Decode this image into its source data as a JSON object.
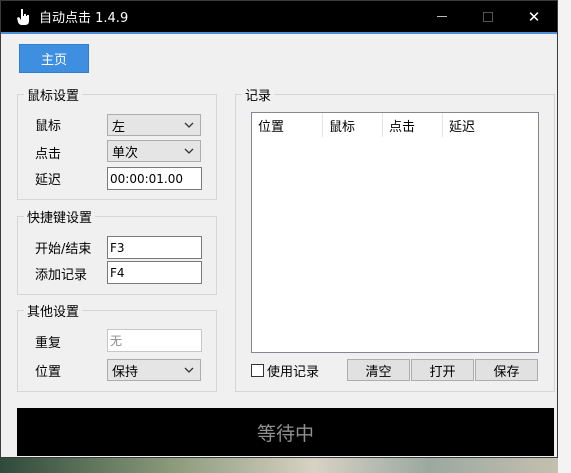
{
  "window": {
    "title": "自动点击 1.4.9"
  },
  "titlebar": {
    "minimize_icon": "minimize-icon",
    "maximize_icon": "maximize-icon",
    "close_icon": "close-icon",
    "close_glyph": "✕"
  },
  "tabs": {
    "home_label": "主页"
  },
  "mouse_settings": {
    "legend": "鼠标设置",
    "mouse_label": "鼠标",
    "mouse_value": "左",
    "click_label": "点击",
    "click_value": "单次",
    "delay_label": "延迟",
    "delay_value": "00:00:01.00"
  },
  "hotkey_settings": {
    "legend": "快捷键设置",
    "start_stop_label": "开始/结束",
    "start_stop_value": "F3",
    "add_record_label": "添加记录",
    "add_record_value": "F4"
  },
  "other_settings": {
    "legend": "其他设置",
    "repeat_label": "重复",
    "repeat_value": "无",
    "position_label": "位置",
    "position_value": "保持"
  },
  "records": {
    "legend": "记录",
    "columns": [
      "位置",
      "鼠标",
      "点击",
      "延迟"
    ],
    "use_records_label": "使用记录",
    "clear_label": "清空",
    "open_label": "打开",
    "save_label": "保存"
  },
  "status": {
    "text": "等待中"
  },
  "colors": {
    "accent": "#3f8fe0",
    "titlebar": "#000000",
    "status_bg": "#000000"
  }
}
